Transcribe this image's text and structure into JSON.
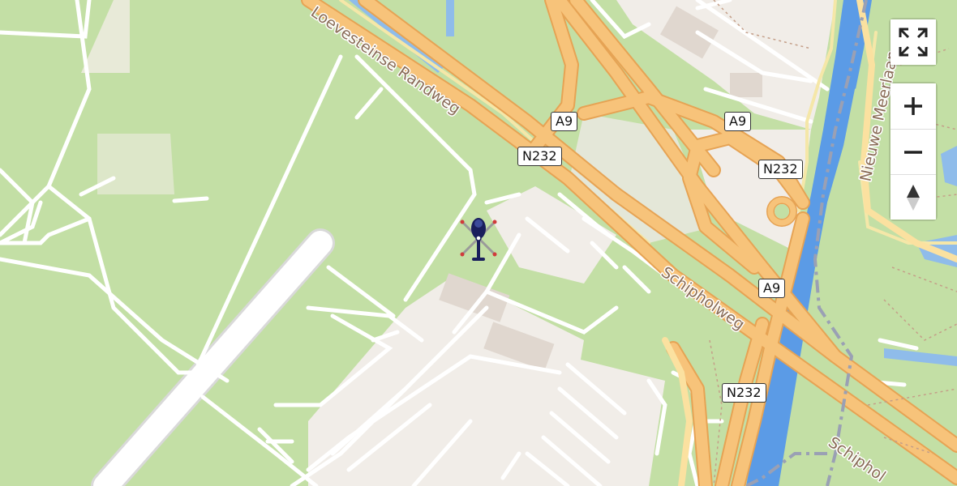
{
  "map": {
    "labels": {
      "loevesteinse": "Loevesteinse Randweg",
      "schipholweg": "Schipholweg",
      "schipholweg_lower": "Schiphol",
      "meerlaan": "Nieuwe Meerlaan"
    },
    "shields": [
      "A9",
      "A9",
      "N232",
      "N232",
      "A9",
      "N232"
    ],
    "marker": {
      "icon": "helicopter-icon"
    }
  },
  "controls": {
    "fullscreen_icon": "fullscreen-icon",
    "zoom_in_icon": "plus-icon",
    "zoom_out_icon": "minus-icon",
    "reset_north_icon": "compass-icon"
  },
  "colors": {
    "grass": "#c3dfa5",
    "motorway": "#f7c37a",
    "motorway_edge": "#e6a354",
    "water": "#5b9be6",
    "apron": "#f1ede8",
    "label": "#8a6d57"
  }
}
